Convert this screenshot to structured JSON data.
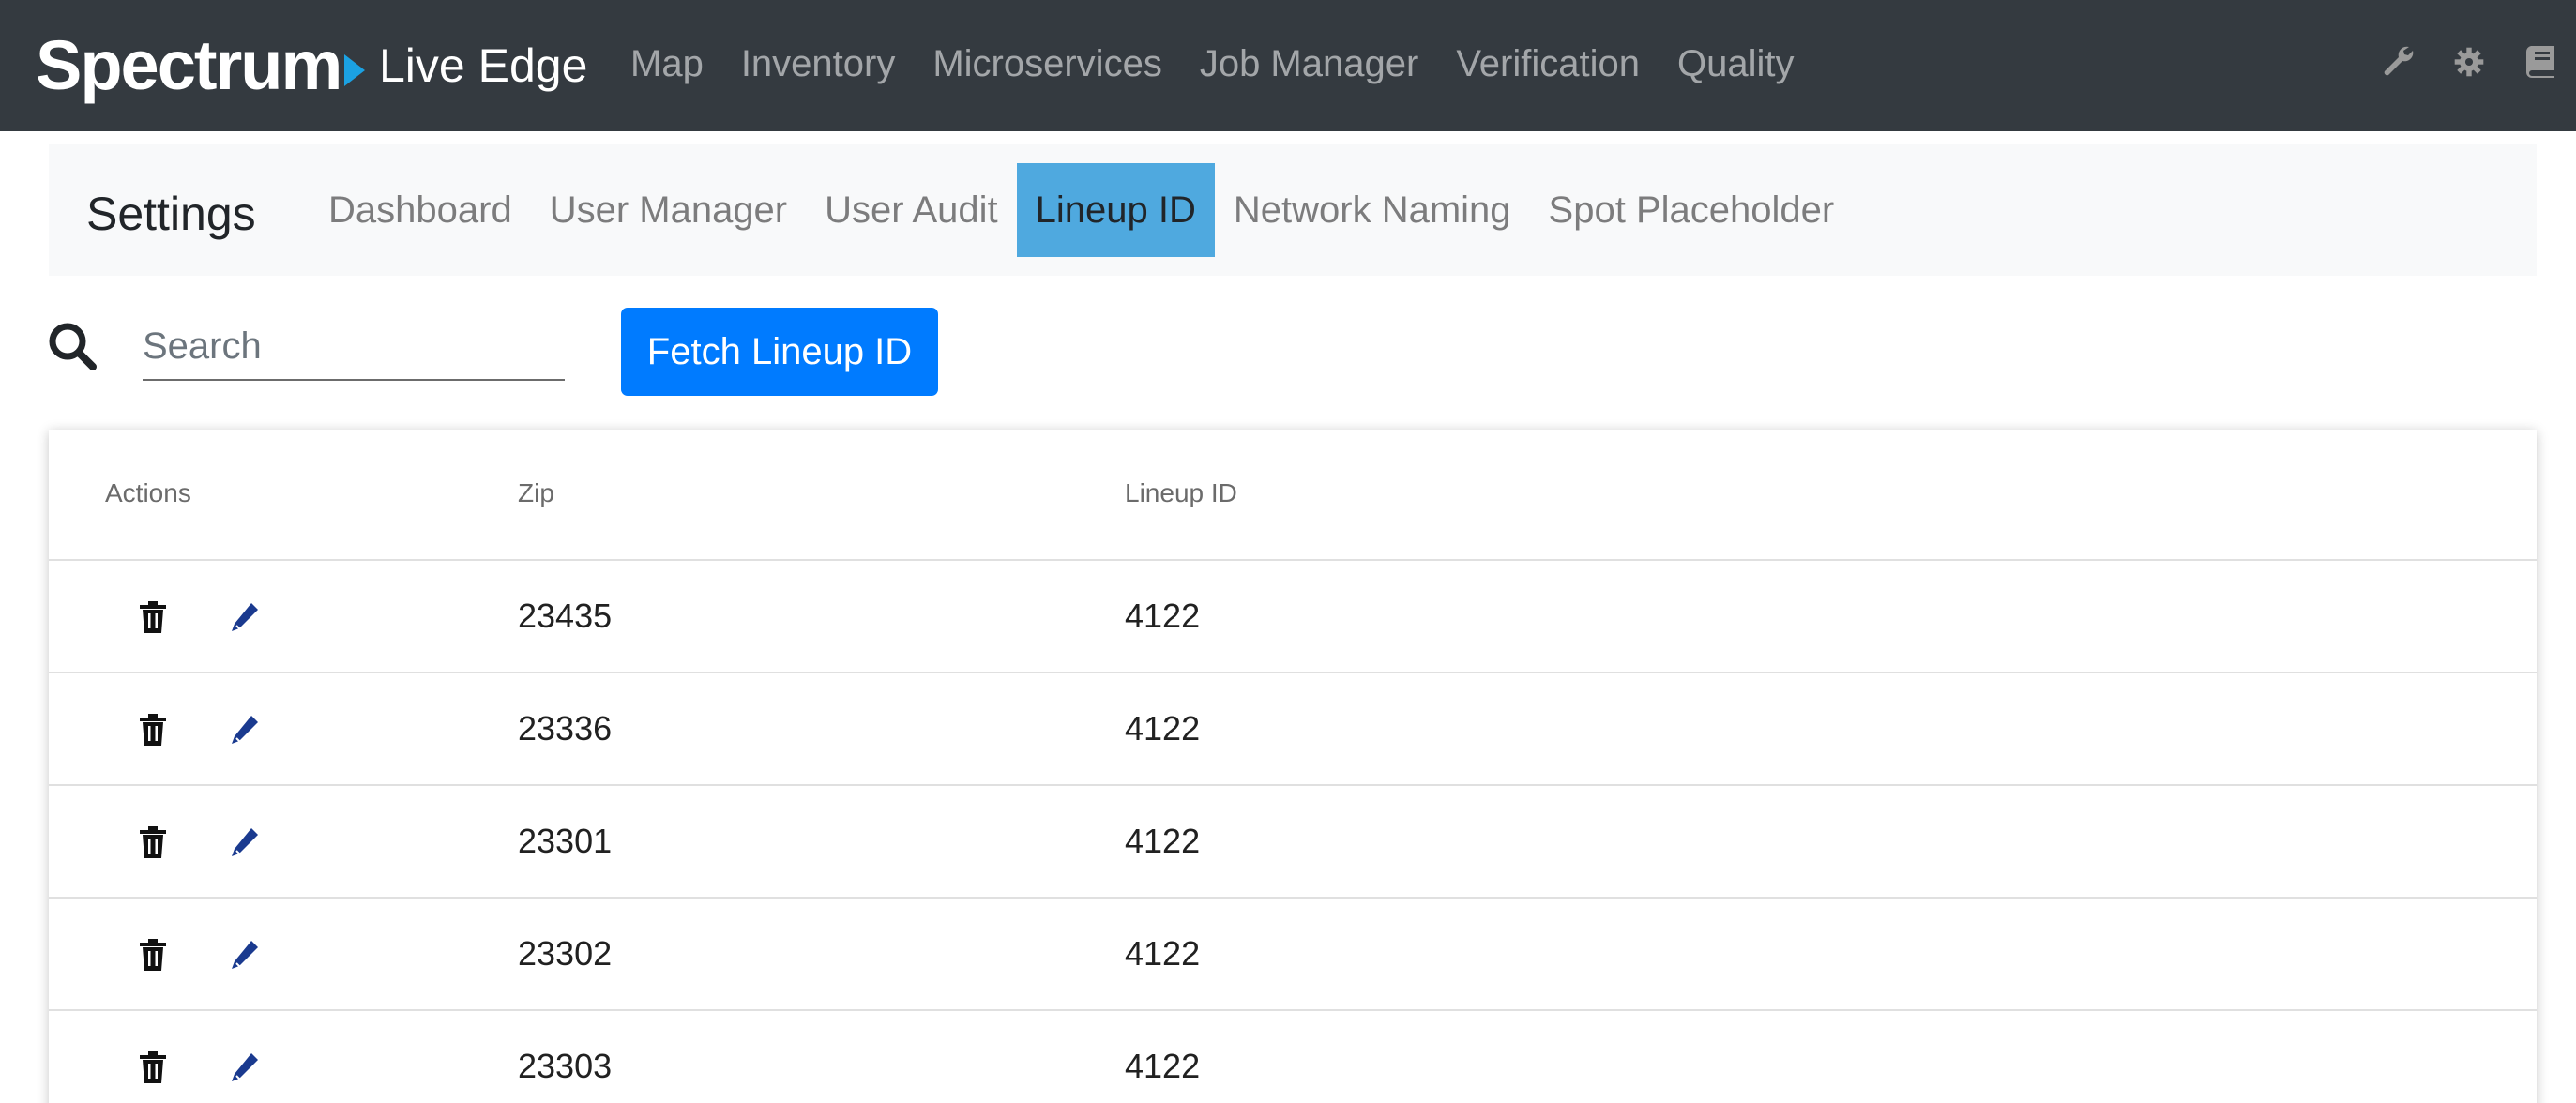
{
  "brand": {
    "name": "Spectrum",
    "app": "Live Edge"
  },
  "topnav": {
    "items": [
      {
        "label": "Map"
      },
      {
        "label": "Inventory"
      },
      {
        "label": "Microservices"
      },
      {
        "label": "Job Manager"
      },
      {
        "label": "Verification"
      },
      {
        "label": "Quality"
      }
    ],
    "icons": [
      "wrench-icon",
      "gear-icon",
      "book-icon"
    ]
  },
  "settings": {
    "title": "Settings",
    "tabs": [
      {
        "label": "Dashboard"
      },
      {
        "label": "User Manager"
      },
      {
        "label": "User Audit"
      },
      {
        "label": "Lineup ID",
        "active": true
      },
      {
        "label": "Network Naming"
      },
      {
        "label": "Spot Placeholder"
      }
    ]
  },
  "search": {
    "placeholder": "Search",
    "value": ""
  },
  "fetch_button": {
    "label": "Fetch Lineup ID"
  },
  "table": {
    "columns": [
      "Actions",
      "Zip",
      "Lineup ID"
    ],
    "rows": [
      {
        "zip": "23435",
        "lineup_id": "4122"
      },
      {
        "zip": "23336",
        "lineup_id": "4122"
      },
      {
        "zip": "23301",
        "lineup_id": "4122"
      },
      {
        "zip": "23302",
        "lineup_id": "4122"
      },
      {
        "zip": "23303",
        "lineup_id": "4122"
      }
    ]
  },
  "colors": {
    "navbar": "#343a40",
    "brand_arrow": "#1ba1e2",
    "active_tab": "#4fa9df",
    "primary_button": "#007bff",
    "edit_icon": "#1a3a8f"
  }
}
